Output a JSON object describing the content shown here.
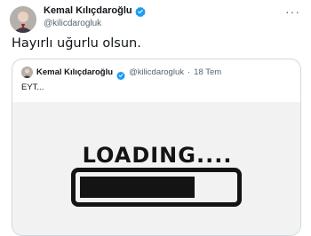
{
  "tweet": {
    "author_name": "Kemal Kılıçdaroğlu",
    "author_handle": "@kilicdarogluk",
    "text": "Hayırlı uğurlu olsun.",
    "more_icon": "more-horizontal-icon",
    "verified_icon": "verified-badge-icon"
  },
  "quote": {
    "author_name": "Kemal Kılıçdaroğlu",
    "author_handle": "@kilicdarogluk",
    "separator": "·",
    "date": "18 Tem",
    "text": "EYT...",
    "media": {
      "loading_text": "LOADING....",
      "progress": 0.75
    }
  },
  "colors": {
    "verified": "#1d9bf0",
    "secondary_text": "#536471",
    "border": "#cfd9de"
  }
}
